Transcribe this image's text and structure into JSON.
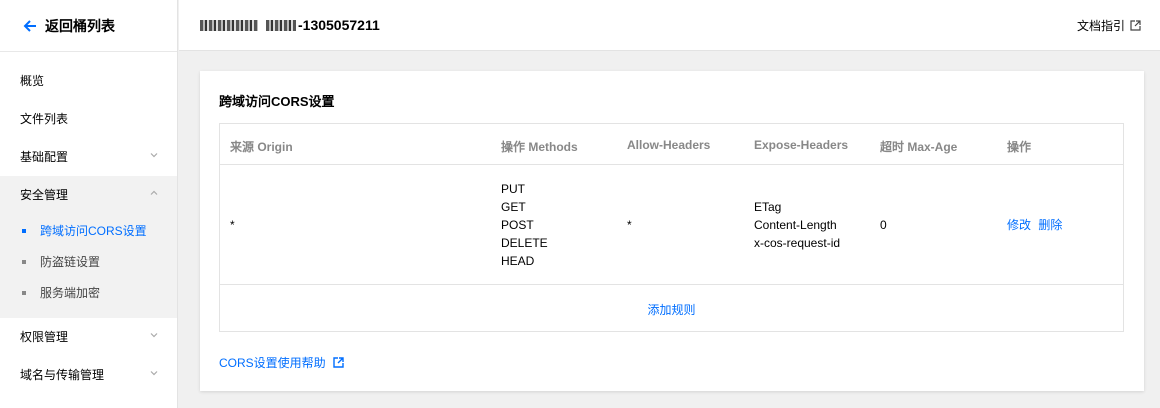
{
  "sidebar": {
    "back_label": "返回桶列表",
    "items": [
      {
        "label": "概览"
      },
      {
        "label": "文件列表"
      },
      {
        "label": "基础配置"
      },
      {
        "label": "安全管理"
      },
      {
        "label": "权限管理"
      },
      {
        "label": "域名与传输管理"
      }
    ],
    "security_sub": [
      {
        "label": "跨域访问CORS设置",
        "active": true
      },
      {
        "label": "防盗链设置"
      },
      {
        "label": "服务端加密"
      }
    ]
  },
  "header": {
    "bucket_suffix": "-1305057211",
    "doc_link": "文档指引"
  },
  "card": {
    "title": "跨域访问CORS设置",
    "columns": [
      "来源 Origin",
      "操作 Methods",
      "Allow-Headers",
      "Expose-Headers",
      "超时 Max-Age",
      "操作"
    ],
    "rows": [
      {
        "origin": "*",
        "methods": [
          "PUT",
          "GET",
          "POST",
          "DELETE",
          "HEAD"
        ],
        "allow_headers": "*",
        "expose_headers": [
          "ETag",
          "Content-Length",
          "x-cos-request-id"
        ],
        "max_age": "0",
        "edit": "修改",
        "delete": "删除"
      }
    ],
    "add_rule": "添加规则",
    "help_link": "CORS设置使用帮助"
  },
  "colors": {
    "accent": "#006eff",
    "page_bg": "#f0f0f0"
  }
}
